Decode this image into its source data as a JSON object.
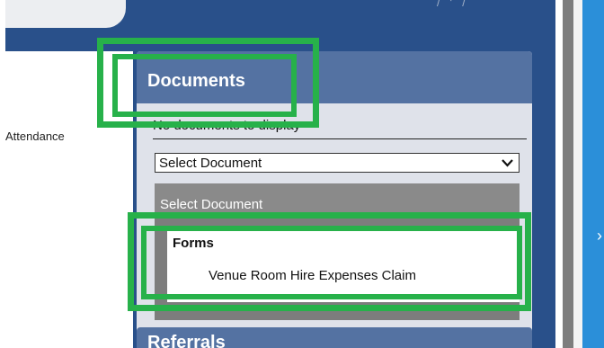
{
  "top_tab": {
    "label": "..."
  },
  "left_panel": {
    "attendance_label": "Attendance"
  },
  "documents": {
    "title": "Documents",
    "empty_text": "No documents to display",
    "select": {
      "selected": "Select Document"
    },
    "dropdown": {
      "header_option": "Select Document",
      "group_label": "Forms",
      "options": [
        "Venue Room Hire Expenses Claim"
      ]
    }
  },
  "lower_panel": {
    "title": "Referrals"
  },
  "right_panel": {
    "chevron": "›"
  },
  "colors": {
    "frame_blue": "#29508a",
    "panel_header": "#5472a2",
    "panel_body": "#dfe2ea",
    "highlight": "#27b14a",
    "right_accent": "#2b8fd9"
  }
}
